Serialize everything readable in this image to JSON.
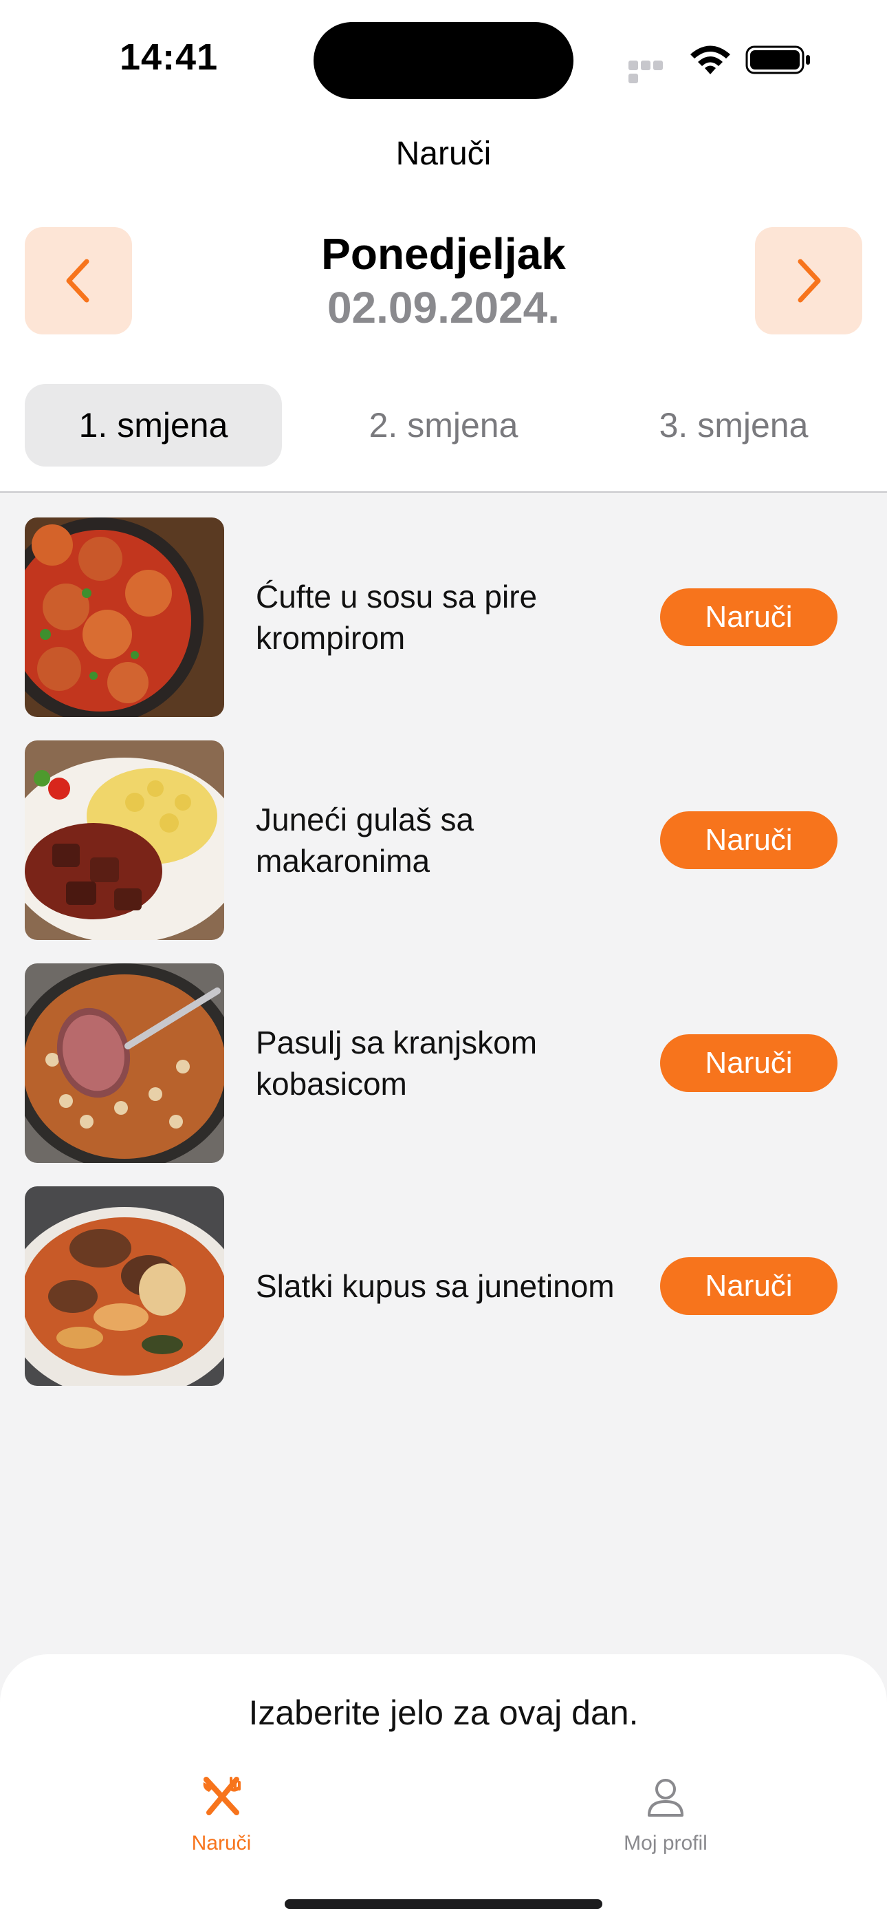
{
  "status_bar": {
    "time": "14:41",
    "icons": [
      "cellular-dots-icon",
      "wifi-icon",
      "battery-icon"
    ]
  },
  "nav": {
    "title": "Naruči"
  },
  "day": {
    "name": "Ponedjeljak",
    "date": "02.09.2024.",
    "prev_icon": "chevron-left-icon",
    "next_icon": "chevron-right-icon"
  },
  "shifts": [
    {
      "label": "1. smjena",
      "selected": true
    },
    {
      "label": "2. smjena",
      "selected": false
    },
    {
      "label": "3. smjena",
      "selected": false
    }
  ],
  "meals": [
    {
      "name": "Ćufte u sosu sa pire krompirom",
      "button": "Naruči",
      "image": "meatballs-in-sauce-photo"
    },
    {
      "name": "Juneći gulaš sa makaronima",
      "button": "Naruči",
      "image": "beef-goulash-pasta-photo"
    },
    {
      "name": "Pasulj sa kranjskom kobasicom",
      "button": "Naruči",
      "image": "bean-stew-sausage-photo"
    },
    {
      "name": "Slatki kupus sa junetinom",
      "button": "Naruči",
      "image": "cabbage-beef-stew-photo"
    }
  ],
  "bottom": {
    "message": "Izaberite jelo za ovaj dan.",
    "tabs": [
      {
        "label": "Naruči",
        "icon": "fork-knife-icon",
        "active": true
      },
      {
        "label": "Moj profil",
        "icon": "person-icon",
        "active": false
      }
    ]
  },
  "colors": {
    "accent": "#f7741c",
    "accent_light": "#fde5d6",
    "background": "#f3f3f4",
    "muted_text": "#8a8a8e"
  }
}
